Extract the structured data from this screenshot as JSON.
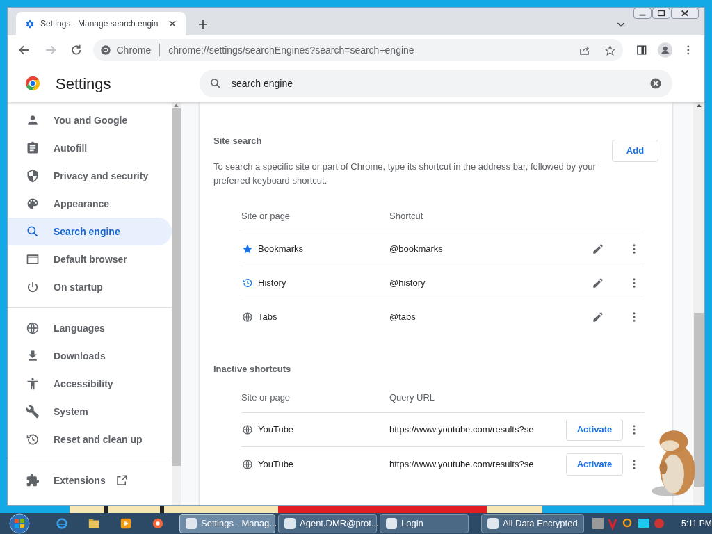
{
  "browser": {
    "tab_title": "Settings - Manage search engin",
    "address_chip": "Chrome",
    "url": "chrome://settings/searchEngines?search=search+engine"
  },
  "settings": {
    "title": "Settings",
    "search": {
      "value": "search engine"
    }
  },
  "sidebar": {
    "items": [
      {
        "label": "You and Google",
        "selected": false
      },
      {
        "label": "Autofill",
        "selected": false
      },
      {
        "label": "Privacy and security",
        "selected": false
      },
      {
        "label": "Appearance",
        "selected": false
      },
      {
        "label": "Search engine",
        "selected": true
      },
      {
        "label": "Default browser",
        "selected": false
      },
      {
        "label": "On startup",
        "selected": false
      },
      {
        "label": "Languages",
        "selected": false
      },
      {
        "label": "Downloads",
        "selected": false
      },
      {
        "label": "Accessibility",
        "selected": false
      },
      {
        "label": "System",
        "selected": false
      },
      {
        "label": "Reset and clean up",
        "selected": false
      },
      {
        "label": "Extensions",
        "selected": false
      }
    ]
  },
  "site_search": {
    "title": "Site search",
    "description": "To search a specific site or part of Chrome, type its shortcut in the address bar, followed by your preferred keyboard shortcut.",
    "add_button": "Add",
    "columns": [
      "Site or page",
      "Shortcut"
    ],
    "rows": [
      {
        "name": "Bookmarks",
        "shortcut": "@bookmarks"
      },
      {
        "name": "History",
        "shortcut": "@history"
      },
      {
        "name": "Tabs",
        "shortcut": "@tabs"
      }
    ]
  },
  "inactive_shortcuts": {
    "title": "Inactive shortcuts",
    "columns": [
      "Site or page",
      "Query URL"
    ],
    "rows": [
      {
        "name": "YouTube",
        "url": "https://www.youtube.com/results?se",
        "button": "Activate"
      },
      {
        "name": "YouTube",
        "url": "https://www.youtube.com/results?se",
        "button": "Activate"
      }
    ]
  },
  "taskbar": {
    "items": [
      {
        "label": "Settings - Manag...",
        "selected": true
      },
      {
        "label": "Agent.DMR@prot...",
        "selected": false
      },
      {
        "label": "Login",
        "selected": false
      },
      {
        "label": "All Data Encrypted",
        "selected": false
      }
    ],
    "clock": "5:11 PM"
  }
}
